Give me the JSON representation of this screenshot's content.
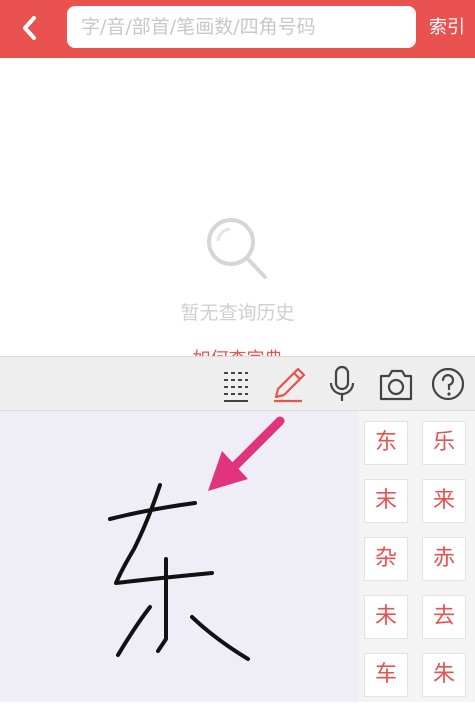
{
  "header": {
    "search_placeholder": "字/音/部首/笔画数/四角号码",
    "index_label": "索引",
    "accent_color": "#e9524f"
  },
  "empty_state": {
    "icon": "magnifier-icon",
    "message": "暂无查询历史",
    "help_link": "如何查字典"
  },
  "toolbar": {
    "tools": [
      "radical-grid-icon",
      "pencil-icon",
      "microphone-icon",
      "camera-icon",
      "help-icon"
    ],
    "active": "pencil-icon"
  },
  "handwriting": {
    "annotation": "pink-arrow-icon"
  },
  "candidates": [
    "东",
    "乐",
    "末",
    "来",
    "杂",
    "赤",
    "未",
    "去",
    "车",
    "朱"
  ]
}
